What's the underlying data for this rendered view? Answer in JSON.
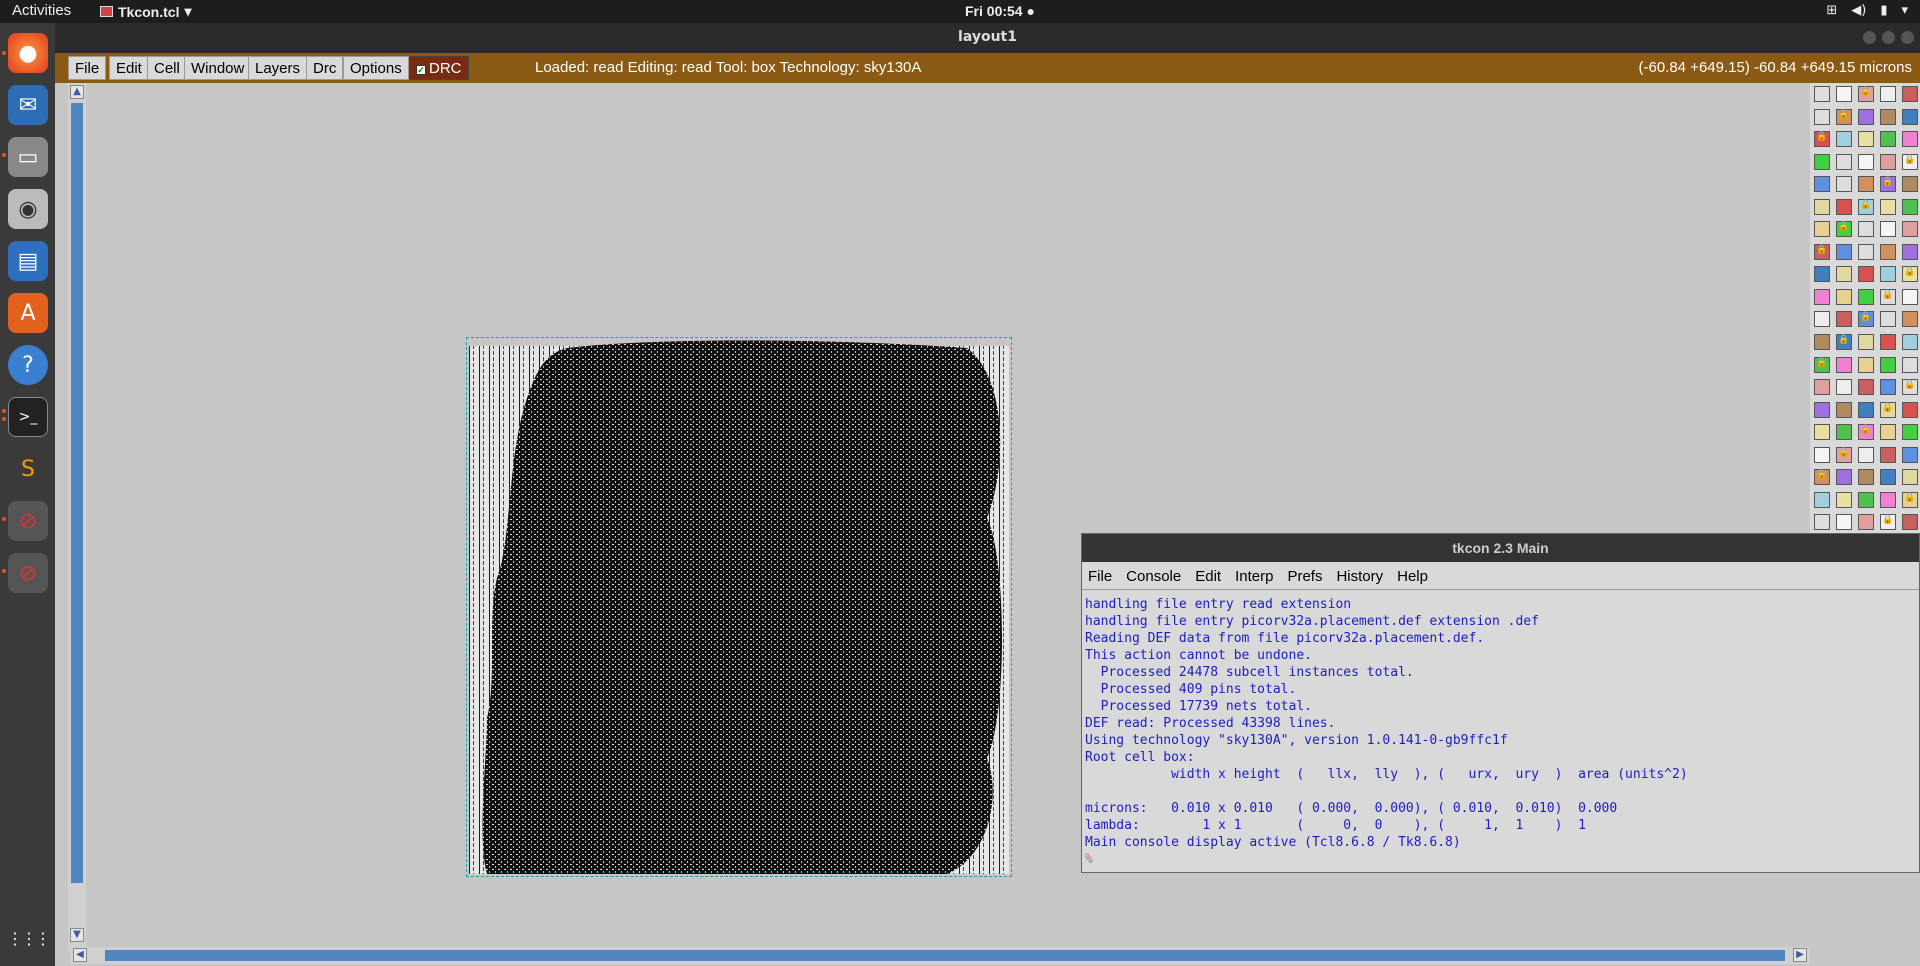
{
  "topbar": {
    "activities": "Activities",
    "app_name": "Tkcon.tcl",
    "clock": "Fri 00:54"
  },
  "dock": {
    "items": [
      "firefox-icon",
      "thunderbird-icon",
      "files-icon",
      "rhythmbox-icon",
      "writer-icon",
      "software-icon",
      "help-icon",
      "terminal-icon",
      "sublime-icon",
      "app-icon-1",
      "app-icon-2"
    ],
    "show_apps": "⋮⋮⋮"
  },
  "window": {
    "title": "layout1"
  },
  "menu": {
    "items": [
      "File",
      "Edit",
      "Cell",
      "Window",
      "Layers",
      "Drc",
      "Options"
    ],
    "drc": "DRC",
    "status": "Loaded: read Editing: read Tool: box  Technology: sky130A",
    "coords": "(-60.84 +649.15) -60.84 +649.15 microns"
  },
  "tkcon": {
    "title": "tkcon 2.3 Main",
    "menu": [
      "File",
      "Console",
      "Edit",
      "Interp",
      "Prefs",
      "History",
      "Help"
    ],
    "lines": [
      "handling file entry read extension",
      "handling file entry picorv32a.placement.def extension .def",
      "Reading DEF data from file picorv32a.placement.def.",
      "This action cannot be undone.",
      "  Processed 24478 subcell instances total.",
      "  Processed 409 pins total.",
      "  Processed 17739 nets total.",
      "DEF read: Processed 43398 lines.",
      "Using technology \"sky130A\", version 1.0.141-0-gb9ffc1f",
      "Root cell box:",
      "           width x height  (   llx,  lly  ), (   urx,  ury  )  area (units^2)",
      "",
      "microns:   0.010 x 0.010   ( 0.000,  0.000), ( 0.010,  0.010)  0.000",
      "lambda:        1 x 1       (     0,  0    ), (     1,  1    )  1",
      "Main console display active (Tcl8.6.8 / Tk8.6.8)"
    ],
    "prompt": "%"
  }
}
